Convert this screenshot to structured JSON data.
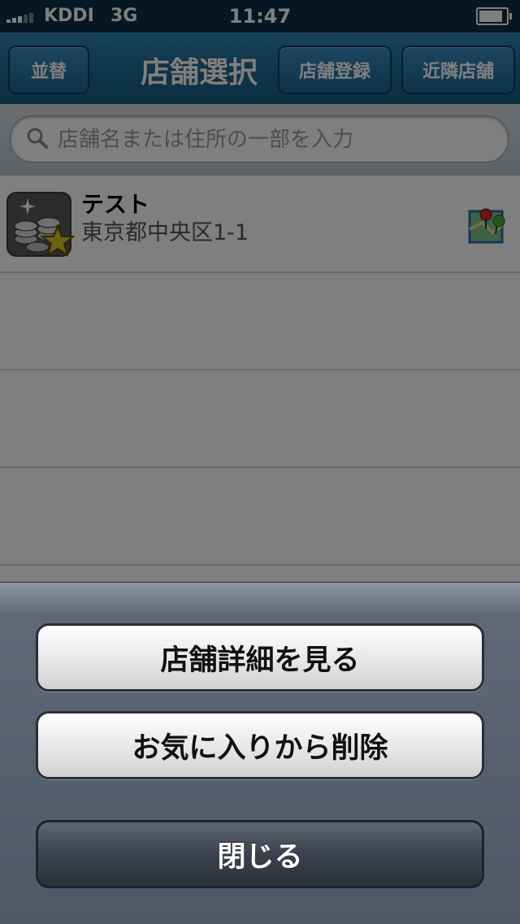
{
  "status_bar": {
    "carrier": "KDDI",
    "network": "3G",
    "time": "11:47"
  },
  "nav": {
    "sort_label": "並替",
    "title": "店舗選択",
    "register_label": "店舗登録",
    "nearby_label": "近隣店舗"
  },
  "search": {
    "placeholder": "店舗名または住所の一部を入力"
  },
  "list": {
    "items": [
      {
        "name": "テスト",
        "address": "東京都中央区1-1"
      }
    ]
  },
  "action_sheet": {
    "detail_label": "店舗詳細を見る",
    "remove_favorite_label": "お気に入りから削除",
    "close_label": "閉じる"
  },
  "colors": {
    "nav_blue": "#1f6b97",
    "status_bar": "#0c2f47",
    "sheet": "#4e5766"
  }
}
